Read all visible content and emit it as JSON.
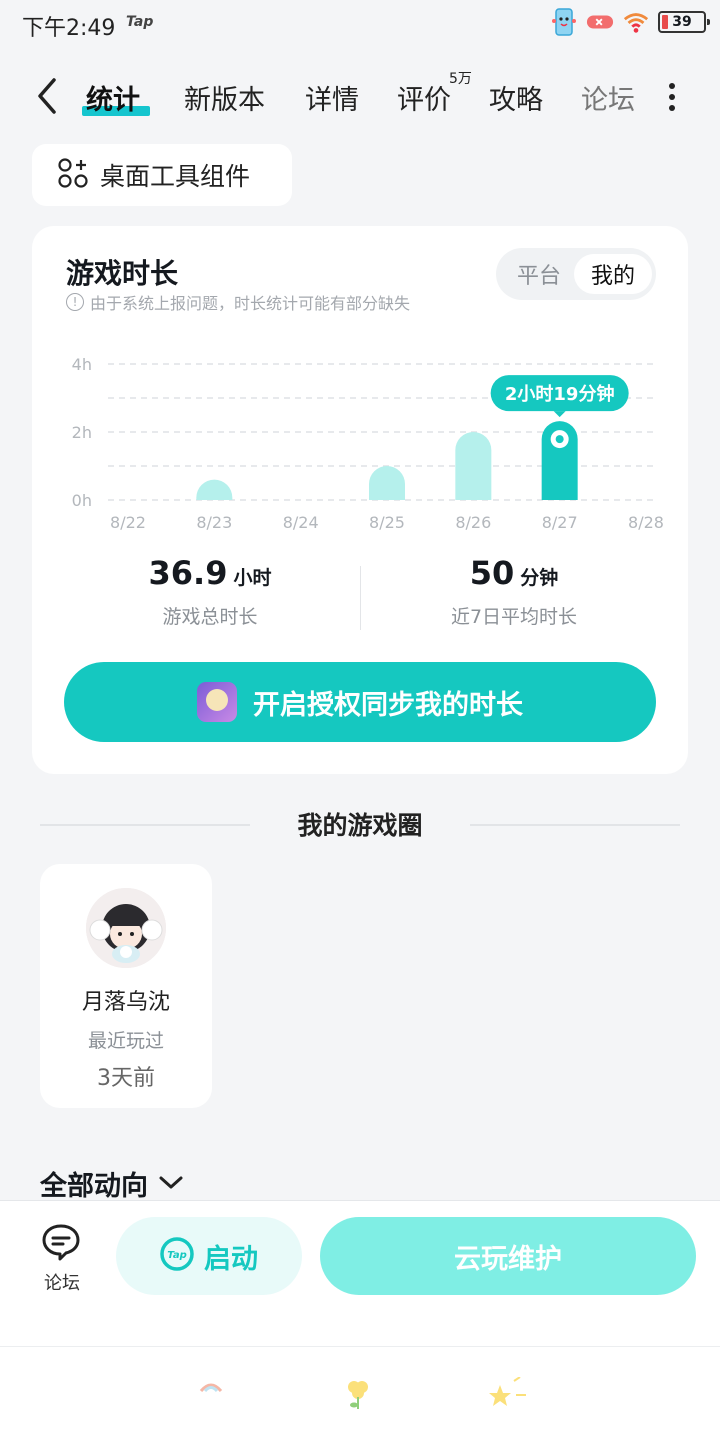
{
  "status_bar": {
    "time": "下午2:49",
    "app_badge": "Tap",
    "battery": "39"
  },
  "tabs": {
    "items": [
      {
        "label": "统计",
        "active": true
      },
      {
        "label": "新版本"
      },
      {
        "label": "详情"
      },
      {
        "label": "评价",
        "badge": "5万"
      },
      {
        "label": "攻略"
      },
      {
        "label": "论坛"
      }
    ]
  },
  "widget_chip": {
    "label": "桌面工具组件"
  },
  "playtime_card": {
    "title": "游戏时长",
    "note": "由于系统上报问题，时长统计可能有部分缺失",
    "toggle": {
      "options": [
        "平台",
        "我的"
      ],
      "selected": "我的"
    },
    "highlight_label": "2小时19分钟",
    "stats": [
      {
        "value": "36.9",
        "unit": "小时",
        "label": "游戏总时长"
      },
      {
        "value": "50",
        "unit": "分钟",
        "label": "近7日平均时长"
      }
    ],
    "sync_button": "开启授权同步我的时长"
  },
  "chart_data": {
    "type": "bar",
    "categories": [
      "8/22",
      "8/23",
      "8/24",
      "8/25",
      "8/26",
      "8/27",
      "8/28"
    ],
    "values": [
      0,
      0.6,
      0,
      1.0,
      2.0,
      2.32,
      0
    ],
    "y_ticks": [
      "4h",
      "2h",
      "0h"
    ],
    "ylim": [
      0,
      4
    ],
    "highlight_index": 5,
    "colors": {
      "bar": "#b5f0ec",
      "highlight": "#15c8c0"
    },
    "grid": true
  },
  "circle_section": {
    "title": "我的游戏圈",
    "friends": [
      {
        "name": "月落乌沈",
        "subtitle": "最近玩过",
        "time": "3天前"
      }
    ]
  },
  "activity_filter": {
    "label": "全部动向"
  },
  "bottom_bar": {
    "forum_label": "论坛",
    "launch_label": "启动",
    "cloud_label": "云玩维护"
  },
  "colors": {
    "accent": "#15c8c0",
    "cloud_button": "#7feee4"
  }
}
